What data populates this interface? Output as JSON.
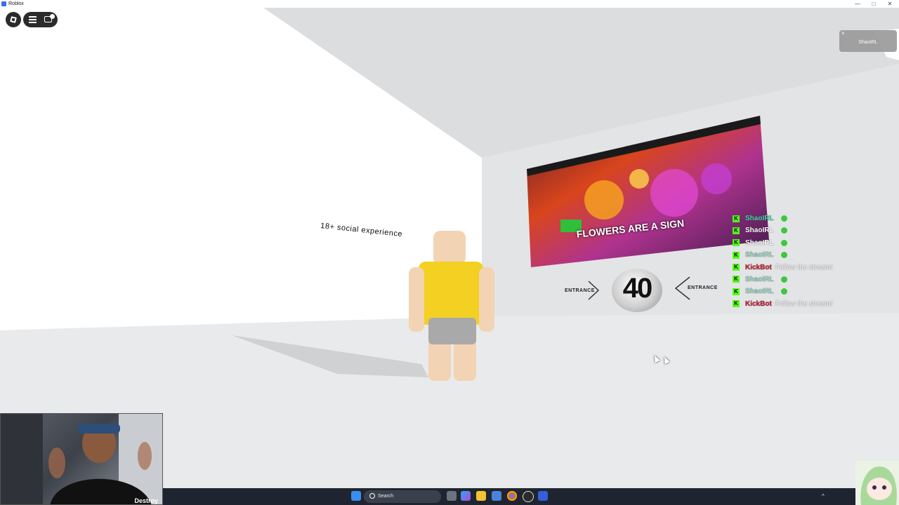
{
  "window": {
    "title": "Roblox"
  },
  "window_controls": {
    "minimize": "—",
    "maximize": "□",
    "close": "✕"
  },
  "hud": {
    "roblox_button_icon": "roblox-logo-icon",
    "menu_icon": "hamburger-menu-icon",
    "chat_icon": "chat-icon"
  },
  "notification": {
    "close": "×",
    "text": "ShaoIRL"
  },
  "world": {
    "wall_text": "18+ social experience",
    "screen_caption": "FLOWERS ARE A SIGN",
    "countdown": "40",
    "entrance_left": "ENTRANCE",
    "entrance_right": "ENTRANCE"
  },
  "chat_feed": [
    {
      "user": "ShaoIRL",
      "message": "",
      "user_color": "#45e0a8",
      "has_emote": true
    },
    {
      "user": "ShaoIRL",
      "message": "",
      "user_color": "#ffffff",
      "has_emote": true
    },
    {
      "user": "ShaoIRL",
      "message": "",
      "user_color": "#ffffff",
      "has_emote": true
    },
    {
      "user": "ShaoIRL",
      "message": "",
      "user_color": "#9fd9c7",
      "has_emote": true
    },
    {
      "user": "KickBot",
      "message": "Follow the stream!",
      "user_color": "#c9243a",
      "has_emote": false
    },
    {
      "user": "ShaoIRL",
      "message": "",
      "user_color": "#9fd9c7",
      "has_emote": true
    },
    {
      "user": "ShaoIRL",
      "message": "",
      "user_color": "#9fd9c7",
      "has_emote": true
    },
    {
      "user": "KickBot",
      "message": "Follow the stream!",
      "user_color": "#c9243a",
      "has_emote": false
    }
  ],
  "webcam": {
    "caption": "Destroy"
  },
  "taskbar": {
    "search_label": "Search",
    "icons": [
      "windows-start-icon",
      "task-view-icon",
      "copilot-icon",
      "file-explorer-icon",
      "store-icon",
      "chrome-icon",
      "obs-icon",
      "roblox-icon"
    ],
    "tray_caret": "^"
  },
  "colors": {
    "kick_green": "#53fc18",
    "taskbar_bg": "#1f2530",
    "scene_floor": "#e6e7e9"
  }
}
